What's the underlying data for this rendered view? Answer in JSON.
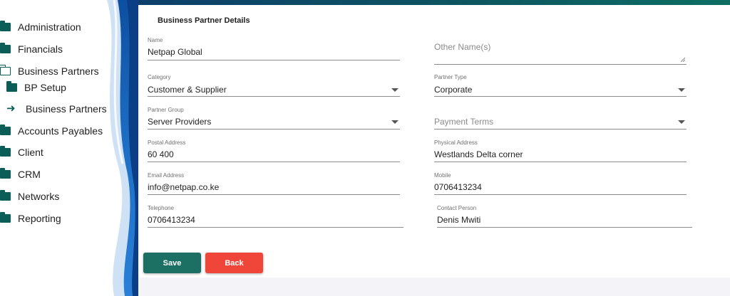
{
  "sidebar": {
    "items": [
      {
        "label": "Administration",
        "icon": "folder-icon"
      },
      {
        "label": "Financials",
        "icon": "folder-icon"
      },
      {
        "label": "Business Partners",
        "icon": "folder-open-icon"
      },
      {
        "label": "BP Setup",
        "icon": "folder-icon"
      },
      {
        "label": "Business Partners",
        "icon": "arrow-right-icon"
      },
      {
        "label": "Accounts Payables",
        "icon": "folder-icon"
      },
      {
        "label": "Client",
        "icon": "folder-icon"
      },
      {
        "label": "CRM",
        "icon": "folder-icon"
      },
      {
        "label": "Networks",
        "icon": "folder-icon"
      },
      {
        "label": "Reporting",
        "icon": "folder-icon"
      }
    ]
  },
  "form": {
    "title": "Business Partner Details",
    "name": {
      "label": "Name",
      "value": "Netpap Global"
    },
    "other_names": {
      "placeholder": "Other Name(s)"
    },
    "category": {
      "label": "Category",
      "value": "Customer & Supplier"
    },
    "partner_type": {
      "label": "Partner Type",
      "value": "Corporate"
    },
    "partner_group": {
      "label": "Partner Group",
      "value": "Server Providers"
    },
    "payment_terms": {
      "placeholder": "Payment Terms"
    },
    "postal_address": {
      "label": "Postal Address",
      "value": "60 400"
    },
    "physical_address": {
      "label": "Physical Address",
      "value": "Westlands Delta corner"
    },
    "email_address": {
      "label": "Email Address",
      "value": "info@netpap.co.ke"
    },
    "mobile": {
      "label": "Mobile",
      "value": "0706413234"
    },
    "telephone": {
      "label": "Telephone",
      "value": "0706413234"
    },
    "contact_person": {
      "label": "Contact Person",
      "value": "Denis Mwiti"
    }
  },
  "actions": {
    "save_label": "Save",
    "back_label": "Back"
  },
  "colors": {
    "primary": "#1c6f63",
    "danger": "#f0463a",
    "folder": "#0b5d57",
    "sidebar_accent": "#1565c0"
  }
}
